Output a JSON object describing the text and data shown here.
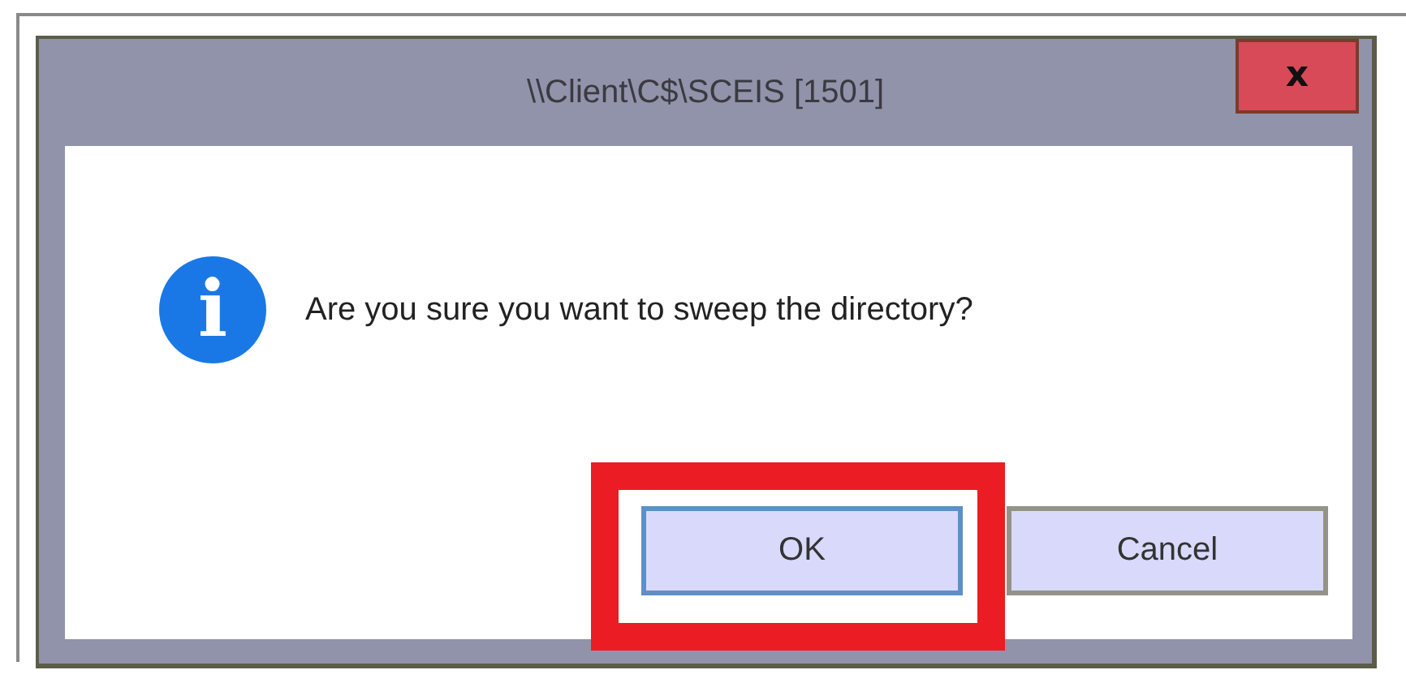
{
  "window": {
    "title": "\\\\Client\\C$\\SCEIS [1501]",
    "close": "x"
  },
  "message": {
    "icon": "i",
    "text": "Are you sure you want to sweep the directory?"
  },
  "buttons": [
    {
      "label": "OK",
      "highlighted": true
    },
    {
      "label": "Cancel",
      "highlighted": false
    }
  ]
}
